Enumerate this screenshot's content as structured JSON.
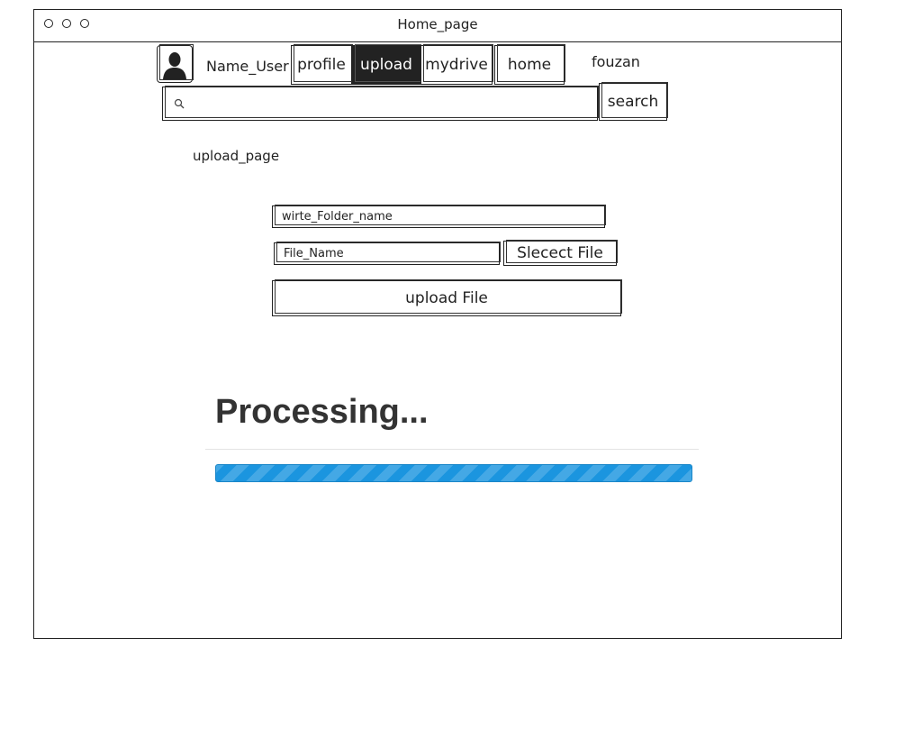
{
  "window": {
    "title": "Home_page"
  },
  "nav": {
    "user_name": "Name_User",
    "tabs": [
      {
        "label": "profile",
        "active": false
      },
      {
        "label": "upload",
        "active": true
      },
      {
        "label": "mydrive",
        "active": false
      },
      {
        "label": "home",
        "active": false
      }
    ],
    "username_right": "fouzan"
  },
  "search": {
    "value": "",
    "button_label": "search"
  },
  "page": {
    "label": "upload_page",
    "folder_field": "wirte_Folder_name",
    "file_field": "File_Name",
    "select_button": "Slecect File",
    "upload_button": "upload File"
  },
  "processing": {
    "title": "Processing...",
    "progress": 1.0,
    "bar_color": "#1b95df"
  }
}
